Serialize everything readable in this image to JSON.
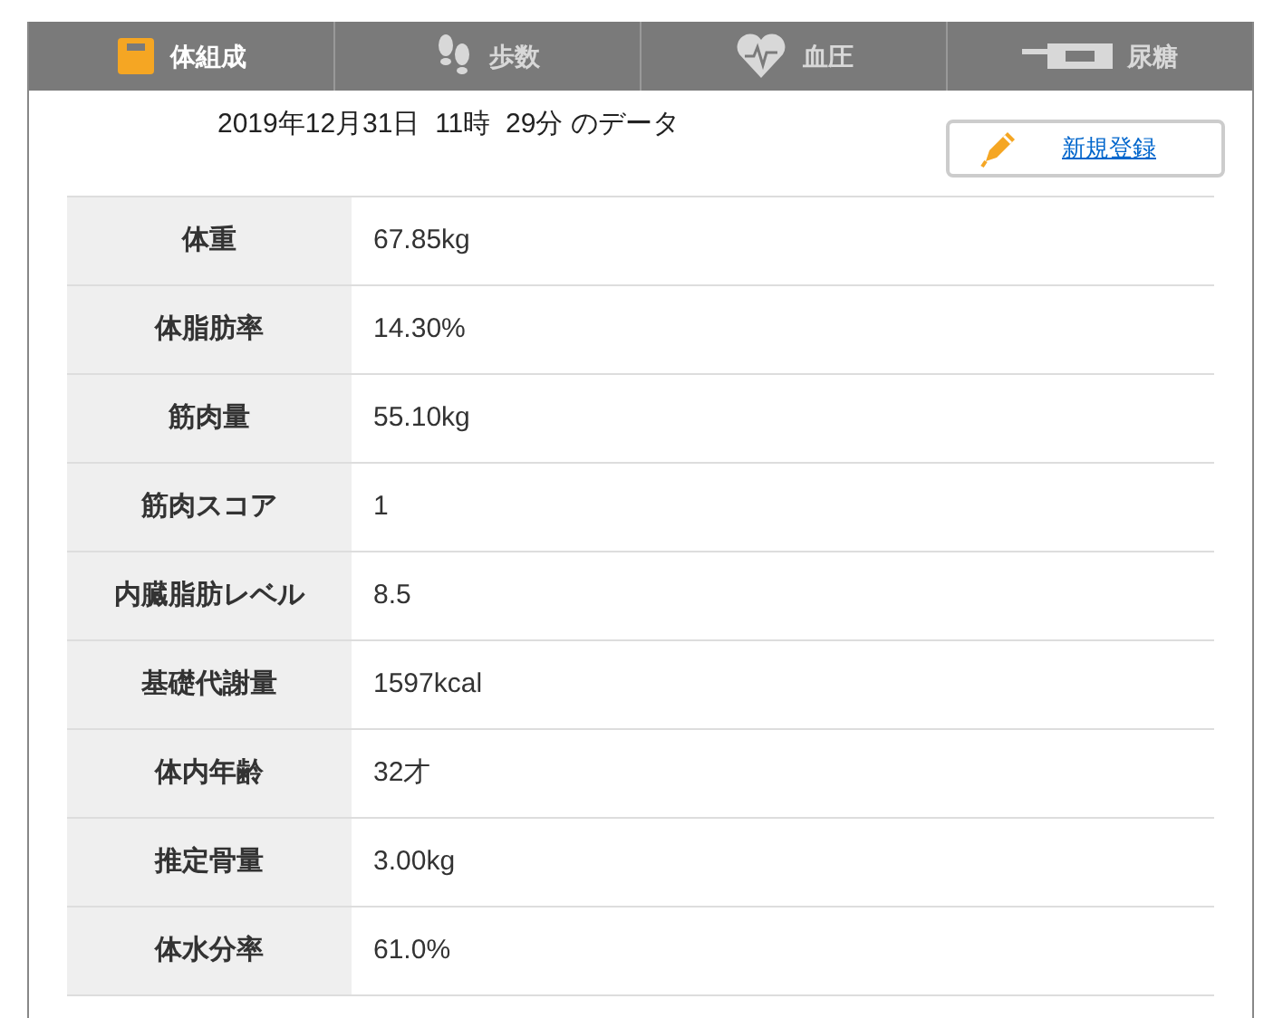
{
  "tabs": [
    {
      "label": "体組成",
      "kind": "scale",
      "selected": true
    },
    {
      "label": "歩数",
      "kind": "steps",
      "selected": false
    },
    {
      "label": "血圧",
      "kind": "heart",
      "selected": false
    },
    {
      "label": "尿糖",
      "kind": "meter",
      "selected": false
    }
  ],
  "date_heading": "2019年12月31日  11時  29分 のデータ",
  "new_entry_button": "新規登録",
  "table": {
    "rows": [
      {
        "label": "体重",
        "value": "67.85kg"
      },
      {
        "label": "体脂肪率",
        "value": "14.30%"
      },
      {
        "label": "筋肉量",
        "value": "55.10kg"
      },
      {
        "label": "筋肉スコア",
        "value": "1"
      },
      {
        "label": "内臓脂肪レベル",
        "value": "8.5"
      },
      {
        "label": "基礎代謝量",
        "value": "1597kcal"
      },
      {
        "label": "体内年齢",
        "value": "32才"
      },
      {
        "label": "推定骨量",
        "value": "3.00kg"
      },
      {
        "label": "体水分率",
        "value": "61.0%"
      }
    ]
  }
}
